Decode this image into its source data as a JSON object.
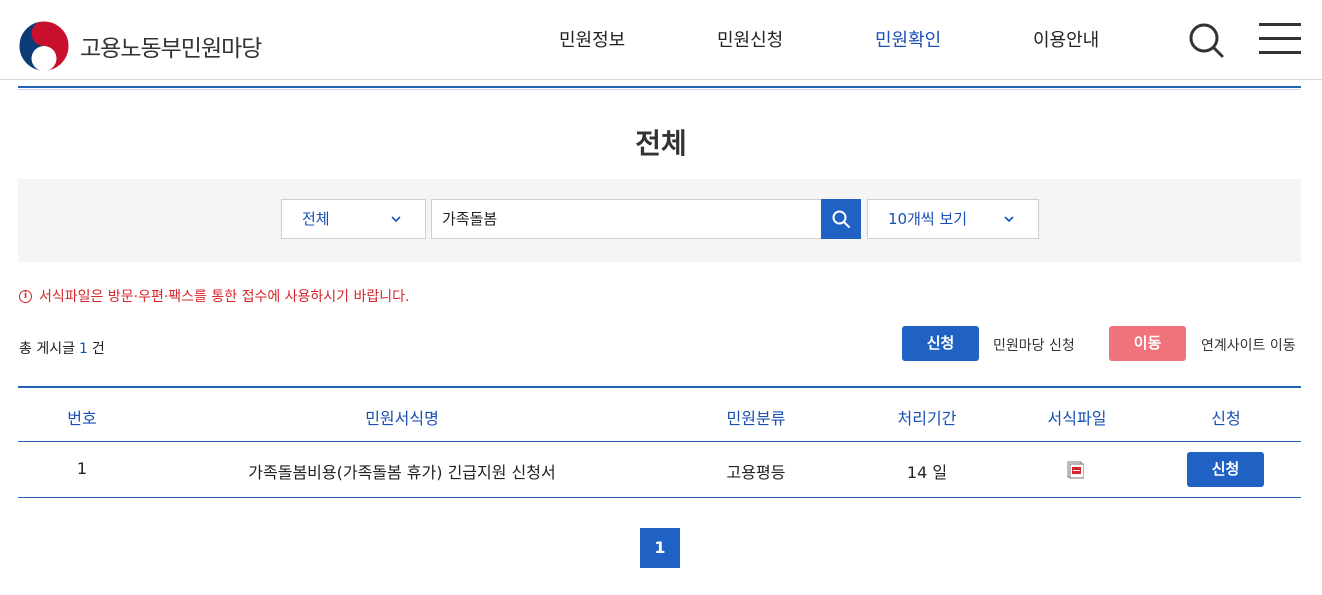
{
  "header": {
    "logo_text": "고용노동부민원마당",
    "nav": [
      "민원정보",
      "민원신청",
      "민원확인",
      "이용안내"
    ],
    "active_nav": "민원확인"
  },
  "page": {
    "title": "전체"
  },
  "search": {
    "category_value": "전체",
    "keyword_value": "가족돌봄",
    "page_size_value": "10개씩 보기"
  },
  "notice": {
    "icon_glyph": "i",
    "text": "서식파일은 방문·우편·팩스를 통한 접수에 사용하시기 바랍니다."
  },
  "summary": {
    "prefix": "총 게시글",
    "count": "1",
    "suffix": "건"
  },
  "legend": {
    "apply_label": "신청",
    "apply_desc": "민원마당 신청",
    "move_label": "이동",
    "move_desc": "연계사이트 이동"
  },
  "table": {
    "headers": [
      "번호",
      "민원서식명",
      "민원분류",
      "처리기간",
      "서식파일",
      "신청"
    ],
    "rows": [
      {
        "no": "1",
        "name": "가족돌봄비용(가족돌봄 휴가) 긴급지원 신청서",
        "category": "고용평등",
        "period": "14 일",
        "action": "신청"
      }
    ]
  },
  "pagination": {
    "current": "1"
  },
  "colors": {
    "primary": "#1f62c3",
    "link_blue": "#1a4fb5",
    "notice_red": "#d6262c",
    "move_pink": "#f0727a"
  }
}
